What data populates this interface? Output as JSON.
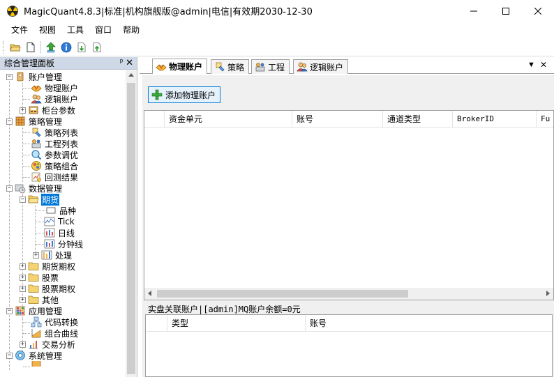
{
  "window": {
    "title": "MagicQuant4.8.3|标准|机构旗舰版@admin|电信|有效期2030-12-30"
  },
  "menu": [
    "文件",
    "视图",
    "工具",
    "窗口",
    "帮助"
  ],
  "left_panel": {
    "title": "综合管理面板",
    "pin_glyph": "ᵖ",
    "close_glyph": "✕",
    "tree": [
      {
        "label": "账户管理",
        "selected": false
      },
      {
        "label": "物理账户",
        "selected": false
      },
      {
        "label": "逻辑账户",
        "selected": false
      },
      {
        "label": "柜台参数",
        "selected": false
      },
      {
        "label": "策略管理",
        "selected": false
      },
      {
        "label": "策略列表",
        "selected": false
      },
      {
        "label": "工程列表",
        "selected": false
      },
      {
        "label": "参数调优",
        "selected": false
      },
      {
        "label": "策略组合",
        "selected": false
      },
      {
        "label": "回测结果",
        "selected": false
      },
      {
        "label": "数据管理",
        "selected": false
      },
      {
        "label": "期货",
        "selected": true
      },
      {
        "label": "品种",
        "selected": false
      },
      {
        "label": "Tick",
        "selected": false
      },
      {
        "label": "日线",
        "selected": false
      },
      {
        "label": "分钟线",
        "selected": false
      },
      {
        "label": "处理",
        "selected": false
      },
      {
        "label": "期货期权",
        "selected": false
      },
      {
        "label": "股票",
        "selected": false
      },
      {
        "label": "股票期权",
        "selected": false
      },
      {
        "label": "其他",
        "selected": false
      },
      {
        "label": "应用管理",
        "selected": false
      },
      {
        "label": "代码转换",
        "selected": false
      },
      {
        "label": "组合曲线",
        "selected": false
      },
      {
        "label": "交易分析",
        "selected": false
      },
      {
        "label": "系统管理",
        "selected": false
      }
    ]
  },
  "tabs": [
    {
      "label": "物理账户",
      "active": true
    },
    {
      "label": "策略",
      "active": false
    },
    {
      "label": "工程",
      "active": false
    },
    {
      "label": "逻辑账户",
      "active": false
    }
  ],
  "tab_controls": {
    "dropdown": "▼",
    "close": "✕"
  },
  "main": {
    "add_button": "添加物理账户",
    "grid1_columns": [
      "资金单元",
      "账号",
      "通道类型",
      "BrokerID",
      "Fu"
    ],
    "subsection_title": "实盘关联账户|[admin]MQ账户余额=0元",
    "grid2_columns": [
      "类型",
      "账号"
    ]
  },
  "colors": {
    "selection": "#0078d7",
    "panel_header": "#cfd8e6",
    "button_border": "#0078d7"
  }
}
